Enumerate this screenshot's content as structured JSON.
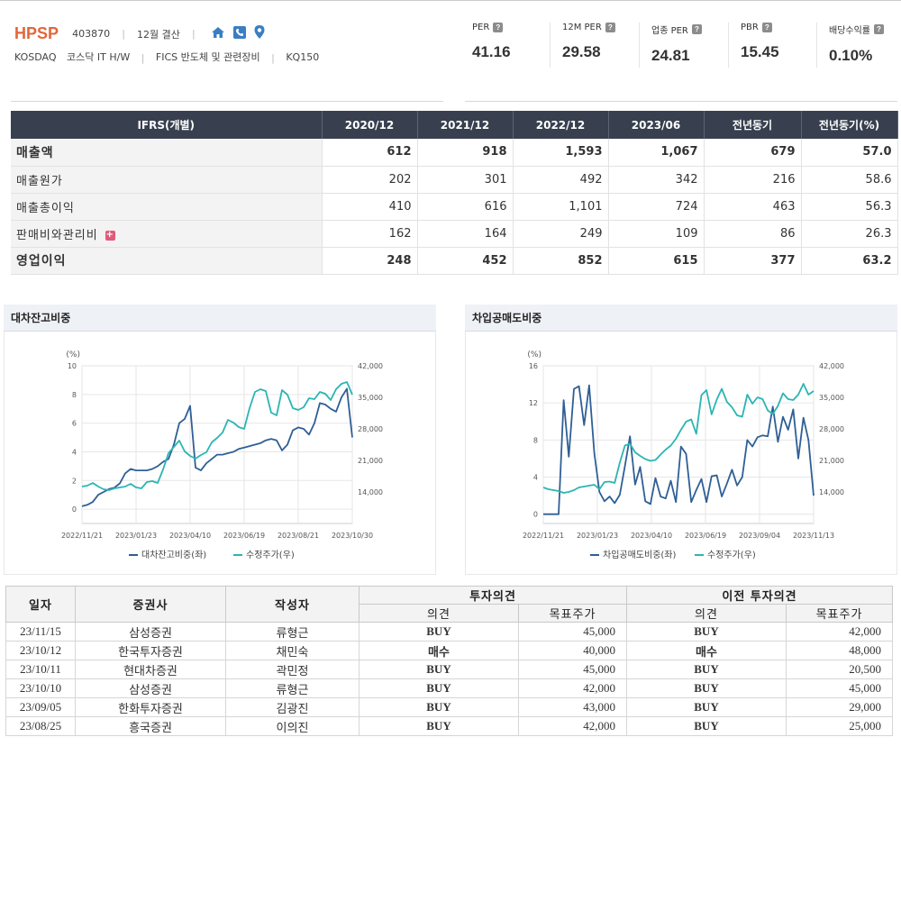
{
  "header": {
    "ticker": "HPSP",
    "code": "403870",
    "settlement": "12월 결산",
    "market": "KOSDAQ",
    "sector1": "코스닥 IT H/W",
    "sector2": "FICS 반도체 및 관련장비",
    "index": "KQ150",
    "icons": [
      "home-icon",
      "phone-icon",
      "location-pin-icon"
    ]
  },
  "metrics": [
    {
      "label": "PER",
      "value": "41.16"
    },
    {
      "label": "12M PER",
      "value": "29.58"
    },
    {
      "label": "업종 PER",
      "value": "24.81"
    },
    {
      "label": "PBR",
      "value": "15.45"
    },
    {
      "label": "배당수익률",
      "value": "0.10%"
    }
  ],
  "financials": {
    "columns": [
      "IFRS(개별)",
      "2020/12",
      "2021/12",
      "2022/12",
      "2023/06",
      "전년동기",
      "전년동기(%)"
    ],
    "rows": [
      {
        "label": "매출액",
        "values": [
          "612",
          "918",
          "1,593",
          "1,067",
          "679",
          "57.0"
        ]
      },
      {
        "label": "매출원가",
        "values": [
          "202",
          "301",
          "492",
          "342",
          "216",
          "58.6"
        ]
      },
      {
        "label": "매출총이익",
        "values": [
          "410",
          "616",
          "1,101",
          "724",
          "463",
          "56.3"
        ]
      },
      {
        "label": "판매비와관리비",
        "values": [
          "162",
          "164",
          "249",
          "109",
          "86",
          "26.3"
        ]
      },
      {
        "label": "영업이익",
        "values": [
          "248",
          "452",
          "852",
          "615",
          "377",
          "63.2"
        ]
      }
    ]
  },
  "colors": {
    "series1": "#2f5f95",
    "series2": "#2bb5b3",
    "accent": "#e2663a",
    "header_bg": "#38404f"
  },
  "chart_data": [
    {
      "type": "line",
      "title": "대차잔고비중",
      "ylabel": "(%)",
      "ylim": [
        -1,
        10
      ],
      "y2lim": [
        7000,
        42000
      ],
      "yticks": [
        0,
        2,
        4,
        6,
        8,
        10
      ],
      "y2ticks": [
        "14,000",
        "21,000",
        "28,000",
        "35,000",
        "42,000"
      ],
      "xticks": [
        "2022/11/21",
        "2023/01/23",
        "2023/04/10",
        "2023/06/19",
        "2023/08/21",
        "2023/10/30"
      ],
      "grid": true,
      "legend_position": "bottom",
      "series": [
        {
          "name": "대차잔고비중(좌)",
          "axis": "left",
          "values": [
            0.2,
            0.3,
            0.5,
            1.0,
            1.2,
            1.4,
            1.5,
            1.8,
            2.5,
            2.8,
            2.7,
            2.7,
            2.7,
            2.8,
            3.0,
            3.3,
            3.5,
            4.5,
            6.0,
            6.3,
            7.2,
            2.9,
            2.7,
            3.2,
            3.5,
            3.8,
            3.8,
            3.9,
            4.0,
            4.2,
            4.3,
            4.4,
            4.5,
            4.6,
            4.8,
            4.9,
            4.8,
            4.1,
            4.5,
            5.5,
            5.7,
            5.6,
            5.2,
            6.0,
            7.4,
            7.3,
            7.0,
            6.8,
            7.8,
            8.4,
            5.0
          ]
        },
        {
          "name": "수정주가(우)",
          "axis": "right",
          "values": [
            15200,
            15400,
            16000,
            15200,
            14600,
            14400,
            14800,
            15000,
            15200,
            15800,
            15000,
            14800,
            16200,
            16400,
            16000,
            19000,
            22600,
            24000,
            25400,
            23000,
            22000,
            21400,
            22200,
            22800,
            25000,
            26000,
            27200,
            30000,
            29400,
            28400,
            28000,
            32600,
            36200,
            36800,
            36400,
            31600,
            31000,
            36600,
            35600,
            32600,
            32200,
            32800,
            34800,
            34600,
            36200,
            35800,
            34400,
            36800,
            38000,
            38400,
            35600
          ]
        }
      ]
    },
    {
      "type": "line",
      "title": "차입공매도비중",
      "ylabel": "(%)",
      "ylim": [
        -1,
        16
      ],
      "y2lim": [
        7000,
        42000
      ],
      "yticks": [
        0,
        4,
        8,
        12,
        16
      ],
      "y2ticks": [
        "14,000",
        "21,000",
        "28,000",
        "35,000",
        "42,000"
      ],
      "xticks": [
        "2022/11/21",
        "2023/01/23",
        "2023/04/10",
        "2023/06/19",
        "2023/09/04",
        "2023/11/13"
      ],
      "grid": true,
      "legend_position": "bottom",
      "series": [
        {
          "name": "차입공매도비중(좌)",
          "axis": "left",
          "values": [
            0,
            0,
            0,
            0,
            12.3,
            6.2,
            13.5,
            13.8,
            9.6,
            13.9,
            6.6,
            2.4,
            1.4,
            1.9,
            1.2,
            2.1,
            5.2,
            8.4,
            3.2,
            5.1,
            1.4,
            1.1,
            3.9,
            1.9,
            1.7,
            3.6,
            1.3,
            7.3,
            6.5,
            1.3,
            2.6,
            3.8,
            1.3,
            4.1,
            4.2,
            1.9,
            3.3,
            4.8,
            3.1,
            4.0,
            8.0,
            7.3,
            8.3,
            8.5,
            8.4,
            11.6,
            7.8,
            10.5,
            9.1,
            11.3,
            6.0,
            10.4,
            8.0,
            2.0
          ]
        },
        {
          "name": "수정주가(우)",
          "axis": "right",
          "values": [
            15000,
            14600,
            14400,
            14200,
            13800,
            14000,
            14400,
            15000,
            15200,
            15400,
            15600,
            14600,
            16200,
            16300,
            16000,
            20500,
            24300,
            24700,
            22800,
            22000,
            21300,
            20900,
            21100,
            22300,
            23400,
            24300,
            25800,
            27800,
            29600,
            30100,
            26900,
            35500,
            36600,
            31200,
            34500,
            36900,
            34000,
            32800,
            31000,
            30700,
            35600,
            33600,
            35000,
            34600,
            32100,
            31300,
            33100,
            35900,
            34600,
            34400,
            35600,
            38000,
            35600,
            36400
          ]
        }
      ]
    }
  ],
  "opinions": {
    "group_headers": [
      "투자의견",
      "이전 투자의견"
    ],
    "columns": [
      "일자",
      "증권사",
      "작성자",
      "의견",
      "목표주가",
      "의견",
      "목표주가"
    ],
    "rows": [
      [
        "23/11/15",
        "삼성증권",
        "류형근",
        "BUY",
        "45,000",
        "BUY",
        "42,000"
      ],
      [
        "23/10/12",
        "한국투자증권",
        "채민숙",
        "매수",
        "40,000",
        "매수",
        "48,000"
      ],
      [
        "23/10/11",
        "현대차증권",
        "곽민정",
        "BUY",
        "45,000",
        "BUY",
        "20,500"
      ],
      [
        "23/10/10",
        "삼성증권",
        "류형근",
        "BUY",
        "42,000",
        "BUY",
        "45,000"
      ],
      [
        "23/09/05",
        "한화투자증권",
        "김광진",
        "BUY",
        "43,000",
        "BUY",
        "29,000"
      ],
      [
        "23/08/25",
        "흥국증권",
        "이의진",
        "BUY",
        "42,000",
        "BUY",
        "25,000"
      ]
    ]
  }
}
